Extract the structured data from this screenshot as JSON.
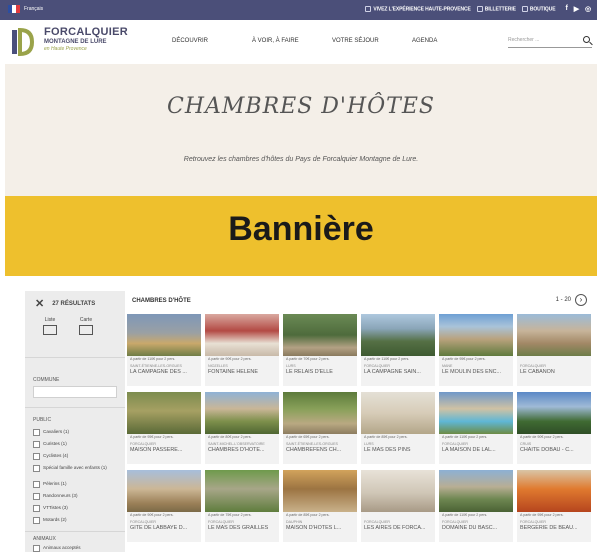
{
  "topbar": {
    "language": "Français",
    "links": [
      "VIVEZ L'EXPÉRIENCE HAUTE-PROVENCE",
      "BILLETTERIE",
      "BOUTIQUE"
    ],
    "social": [
      "f",
      "▶",
      "◎"
    ]
  },
  "brand": {
    "name": "FORCALQUIER",
    "subtitle": "MONTAGNE DE LURE",
    "tagline": "en Haute Provence"
  },
  "nav": [
    "DÉCOUVRIR",
    "À VOIR, À FAIRE",
    "VOTRE SÉJOUR",
    "AGENDA"
  ],
  "search": {
    "placeholder": "Rechercher ..."
  },
  "hero": {
    "title": "CHAMBRES D'HÔTES",
    "subtitle": "Retrouvez les chambres d'hôtes du Pays de Forcalquier Montagne de Lure."
  },
  "banner": {
    "text": "Bannière"
  },
  "sidebar": {
    "results": "27 RÉSULTATS",
    "view_list": "Liste",
    "view_map": "Carte",
    "commune_label": "COMMUNE",
    "public_label": "PUBLIC",
    "public_options": [
      "Cavaliers (1)",
      "Curistes (1)",
      "Cyclistes (4)",
      "Spécial famille avec enfants (1)",
      "Pèlerins (1)",
      "Randonneurs (3)",
      "VTTistes (3)",
      "Motards (2)"
    ],
    "animals_label": "ANIMAUX",
    "animals_option": "Animaux acceptés"
  },
  "listing": {
    "title": "CHAMBRES D'HÔTE",
    "range": "1 - 20",
    "cards": [
      {
        "loc": "SAINT-ÉTIENNE-LES-ORGUES",
        "name": "LA CAMPAGNE DES ...",
        "price": "A partir de 110€ pour 2 pers."
      },
      {
        "loc": "NIOZELLES",
        "name": "FONTAINE HÉLÈNE",
        "price": "A partir de 90€ pour 2 pers."
      },
      {
        "loc": "LURS",
        "name": "LE RELAIS D'ELLE",
        "price": "A partir de 70€ pour 2 pers."
      },
      {
        "loc": "FORCALQUIER",
        "name": "LA CAMPAGNE SAIN...",
        "price": "A partir de 110€ pour 2 pers."
      },
      {
        "loc": "MANE",
        "name": "LE MOULIN DES ENC...",
        "price": "A partir de 95€ pour 2 pers."
      },
      {
        "loc": "FORCALQUIER",
        "name": "LE CABANON",
        "price": ""
      },
      {
        "loc": "FORCALQUIER",
        "name": "MAISON PASSERE...",
        "price": "A partir de 95€ pour 2 pers."
      },
      {
        "loc": "SAINT-MICHEL-L'OBSERVATOIRE",
        "name": "CHAMBRES D'HÔTE...",
        "price": "A partir de 80€ pour 2 pers."
      },
      {
        "loc": "SAINT-ÉTIENNE-LES-ORGUES",
        "name": "CHAMBREFENS CH...",
        "price": "A partir de 65€ pour 2 pers."
      },
      {
        "loc": "LURS",
        "name": "LE MAS DES PINS",
        "price": "A partir de 85€ pour 2 pers."
      },
      {
        "loc": "FORCALQUIER",
        "name": "LA MAISON DE LAL...",
        "price": "A partir de 110€ pour 2 pers."
      },
      {
        "loc": "CRUIS",
        "name": "CHAÏTE DOBAU - C...",
        "price": "A partir de 90€ pour 2 pers."
      },
      {
        "loc": "FORCALQUIER",
        "name": "GITE DE LABBAYE D...",
        "price": "A partir de 90€ pour 2 pers."
      },
      {
        "loc": "FORCALQUIER",
        "name": "LE MAS DES GRAILLES",
        "price": "A partir de 75€ pour 2 pers."
      },
      {
        "loc": "DAUPHIN",
        "name": "MAISON D'HÔTES L...",
        "price": "A partir de 85€ pour 2 pers."
      },
      {
        "loc": "FORCALQUIER",
        "name": "LES AIRES DE FORCA...",
        "price": ""
      },
      {
        "loc": "FORCALQUIER",
        "name": "DOMAINE DU BASC...",
        "price": "A partir de 110€ pour 2 pers."
      },
      {
        "loc": "FORCALQUIER",
        "name": "BERGERIE DE BEAU...",
        "price": "A partir de 95€ pour 2 pers."
      }
    ]
  },
  "colors": {
    "topbar": "#4b4f79",
    "banner": "#eec02d",
    "hero_bg": "#f4efe8",
    "sidebar_bg": "#ececec"
  }
}
